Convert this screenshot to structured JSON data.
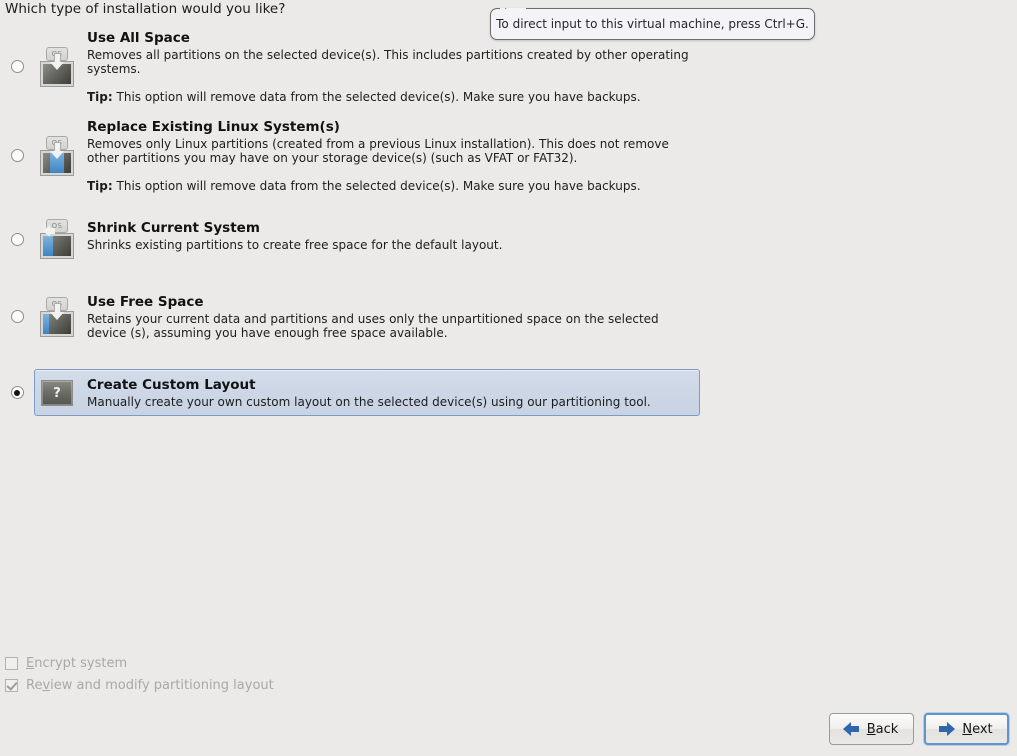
{
  "page": {
    "question": "Which type of installation would you like?"
  },
  "tooltip": {
    "text": "To direct input to this virtual machine, press Ctrl+G."
  },
  "options": [
    {
      "id": "use-all-space",
      "title": "Use All Space",
      "description": "Removes all partitions on the selected device(s).  This includes partitions created by other operating systems.",
      "tip_label": "Tip:",
      "tip_text": "This option will remove data from the selected device(s).  Make sure you have backups.",
      "icon": "disk-os-overwrite-icon",
      "icon_badge": "OS",
      "selected": false
    },
    {
      "id": "replace-existing-linux",
      "title": "Replace Existing Linux System(s)",
      "description": "Removes only Linux partitions (created from a previous Linux installation).  This does not remove other partitions you may have on your storage device(s) (such as VFAT or FAT32).",
      "tip_label": "Tip:",
      "tip_text": "This option will remove data from the selected device(s).  Make sure you have backups.",
      "icon": "disk-os-replace-icon",
      "icon_badge": "OS",
      "selected": false
    },
    {
      "id": "shrink-current-system",
      "title": "Shrink Current System",
      "description": "Shrinks existing partitions to create free space for the default layout.",
      "tip_label": "",
      "tip_text": "",
      "icon": "disk-os-shrink-icon",
      "icon_badge": "OS",
      "selected": false
    },
    {
      "id": "use-free-space",
      "title": "Use Free Space",
      "description": "Retains your current data and partitions and uses only the unpartitioned space on the selected device (s), assuming you have enough free space available.",
      "tip_label": "",
      "tip_text": "",
      "icon": "disk-os-free-space-icon",
      "icon_badge": "OS",
      "selected": false
    },
    {
      "id": "create-custom-layout",
      "title": "Create Custom Layout",
      "description": "Manually create your own custom layout on the selected device(s) using our partitioning tool.",
      "tip_label": "",
      "tip_text": "",
      "icon": "disk-question-icon",
      "icon_badge": "?",
      "selected": true
    }
  ],
  "checkboxes": [
    {
      "id": "encrypt-system",
      "label_before": "",
      "label_mnemonic": "E",
      "label_after": "ncrypt system",
      "checked": false,
      "disabled": true
    },
    {
      "id": "review-modify-partitioning",
      "label_before": "Re",
      "label_mnemonic": "v",
      "label_after": "iew and modify partitioning layout",
      "checked": true,
      "disabled": true
    }
  ],
  "buttons": {
    "back": {
      "label_before": "",
      "label_mnemonic": "B",
      "label_after": "ack",
      "icon": "arrow-left-icon",
      "focused": false
    },
    "next": {
      "label_before": "",
      "label_mnemonic": "N",
      "label_after": "ext",
      "icon": "arrow-right-icon",
      "focused": true
    }
  },
  "colors": {
    "background": "#eceae8",
    "selected_row_bg": "#cdd7e6",
    "selected_row_border": "#7e9bc4",
    "accent_blue": "#2f66ac",
    "disabled_text": "#a9a8a4"
  }
}
